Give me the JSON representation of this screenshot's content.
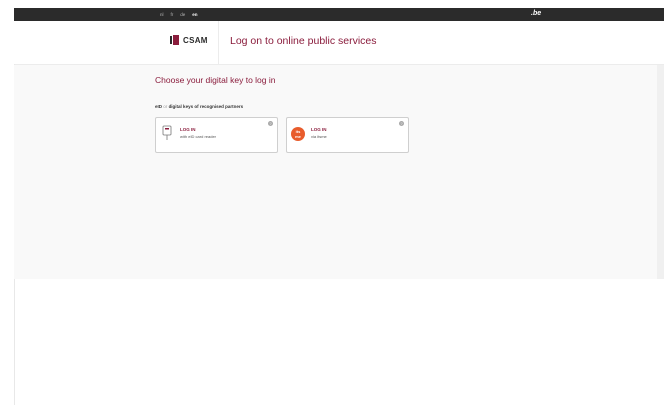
{
  "topbar": {
    "languages": [
      {
        "label": "nl",
        "active": false
      },
      {
        "label": "fr",
        "active": false
      },
      {
        "label": "de",
        "active": false
      },
      {
        "label": "en",
        "active": true
      }
    ],
    "be_label": ".be"
  },
  "header": {
    "logo_text": "CSAM",
    "title": "Log on to online public services"
  },
  "main": {
    "choose_title": "Choose your digital key to log in",
    "subtitle_part1": "eID",
    "subtitle_or": "or",
    "subtitle_part2": "digital keys of recognised partners",
    "cards": [
      {
        "title": "LOG IN",
        "subtitle": "with eID card reader",
        "help": "?"
      },
      {
        "title": "LOG IN",
        "subtitle": "via itsme",
        "help": "?",
        "icon_text_top": "its",
        "icon_text_bottom": "me"
      }
    ]
  },
  "colors": {
    "accent": "#8a1c3c",
    "topbar": "#2b2b2b",
    "itsme": "#e85c2c"
  }
}
